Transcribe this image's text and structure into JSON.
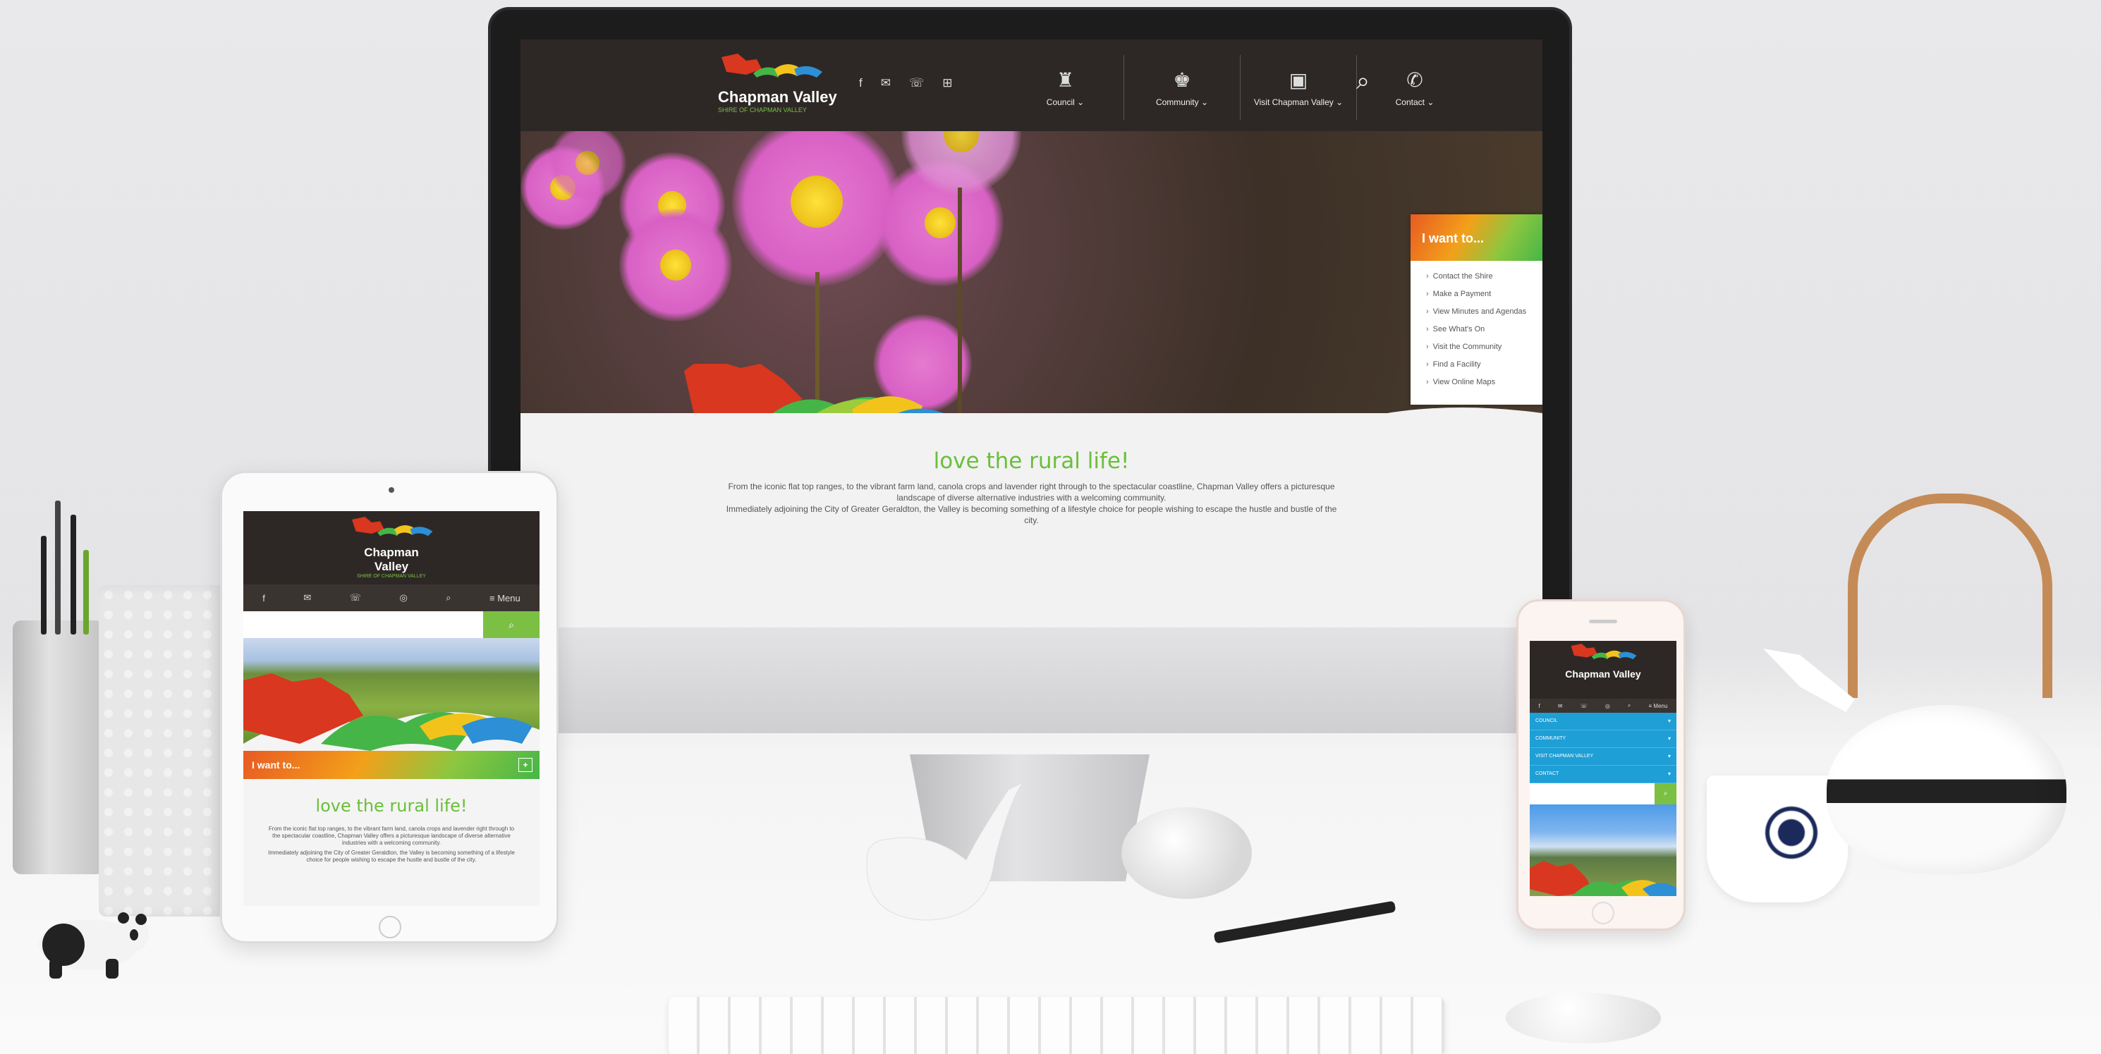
{
  "site": {
    "logo_name": "Chapman Valley",
    "logo_tagline": "SHIRE OF CHAPMAN VALLEY",
    "social_icons": [
      "facebook-icon",
      "mail-icon",
      "phone-icon",
      "map-icon"
    ],
    "menu": [
      {
        "label": "Council ⌄",
        "icon": "♜"
      },
      {
        "label": "Community ⌄",
        "icon": "♚"
      },
      {
        "label": "Visit Chapman Valley ⌄",
        "icon": "▣"
      },
      {
        "label": "Contact ⌄",
        "icon": "✆"
      }
    ],
    "search_icon": "search-icon",
    "i_want_to": {
      "title": "I want to...",
      "items": [
        "Contact the Shire",
        "Make a Payment",
        "View Minutes and Agendas",
        "See What's On",
        "Visit the Community",
        "Find a Facility",
        "View Online Maps"
      ]
    },
    "heading": "love the rural life!",
    "paragraph_1": "From the iconic flat top ranges, to the vibrant farm land, canola crops and lavender right through to the spectacular coastline, Chapman Valley offers a picturesque landscape of diverse alternative industries with a welcoming community.",
    "paragraph_2": "Immediately adjoining the City of Greater Geraldton, the Valley is becoming something of a lifestyle choice for people wishing to escape the hustle and bustle of the city."
  },
  "tablet": {
    "iconbar": [
      "f",
      "✉",
      "☏",
      "◎",
      "⌕",
      "≡ Menu"
    ],
    "search_button": "⌕",
    "i_want_to": "I want to...",
    "plus": "+"
  },
  "phone": {
    "iconbar": [
      "f",
      "✉",
      "☏",
      "◎",
      "⌕",
      "≡ Menu"
    ],
    "menu": [
      "COUNCIL",
      "COMMUNITY",
      "VISIT CHAPMAN VALLEY",
      "CONTACT"
    ],
    "search_button": "⌕"
  },
  "colors": {
    "nav_dark": "#2d2826",
    "accent_green": "#6abf3a",
    "phone_menu_blue": "#1e9fd6",
    "flower_pink": "#d860c4"
  }
}
